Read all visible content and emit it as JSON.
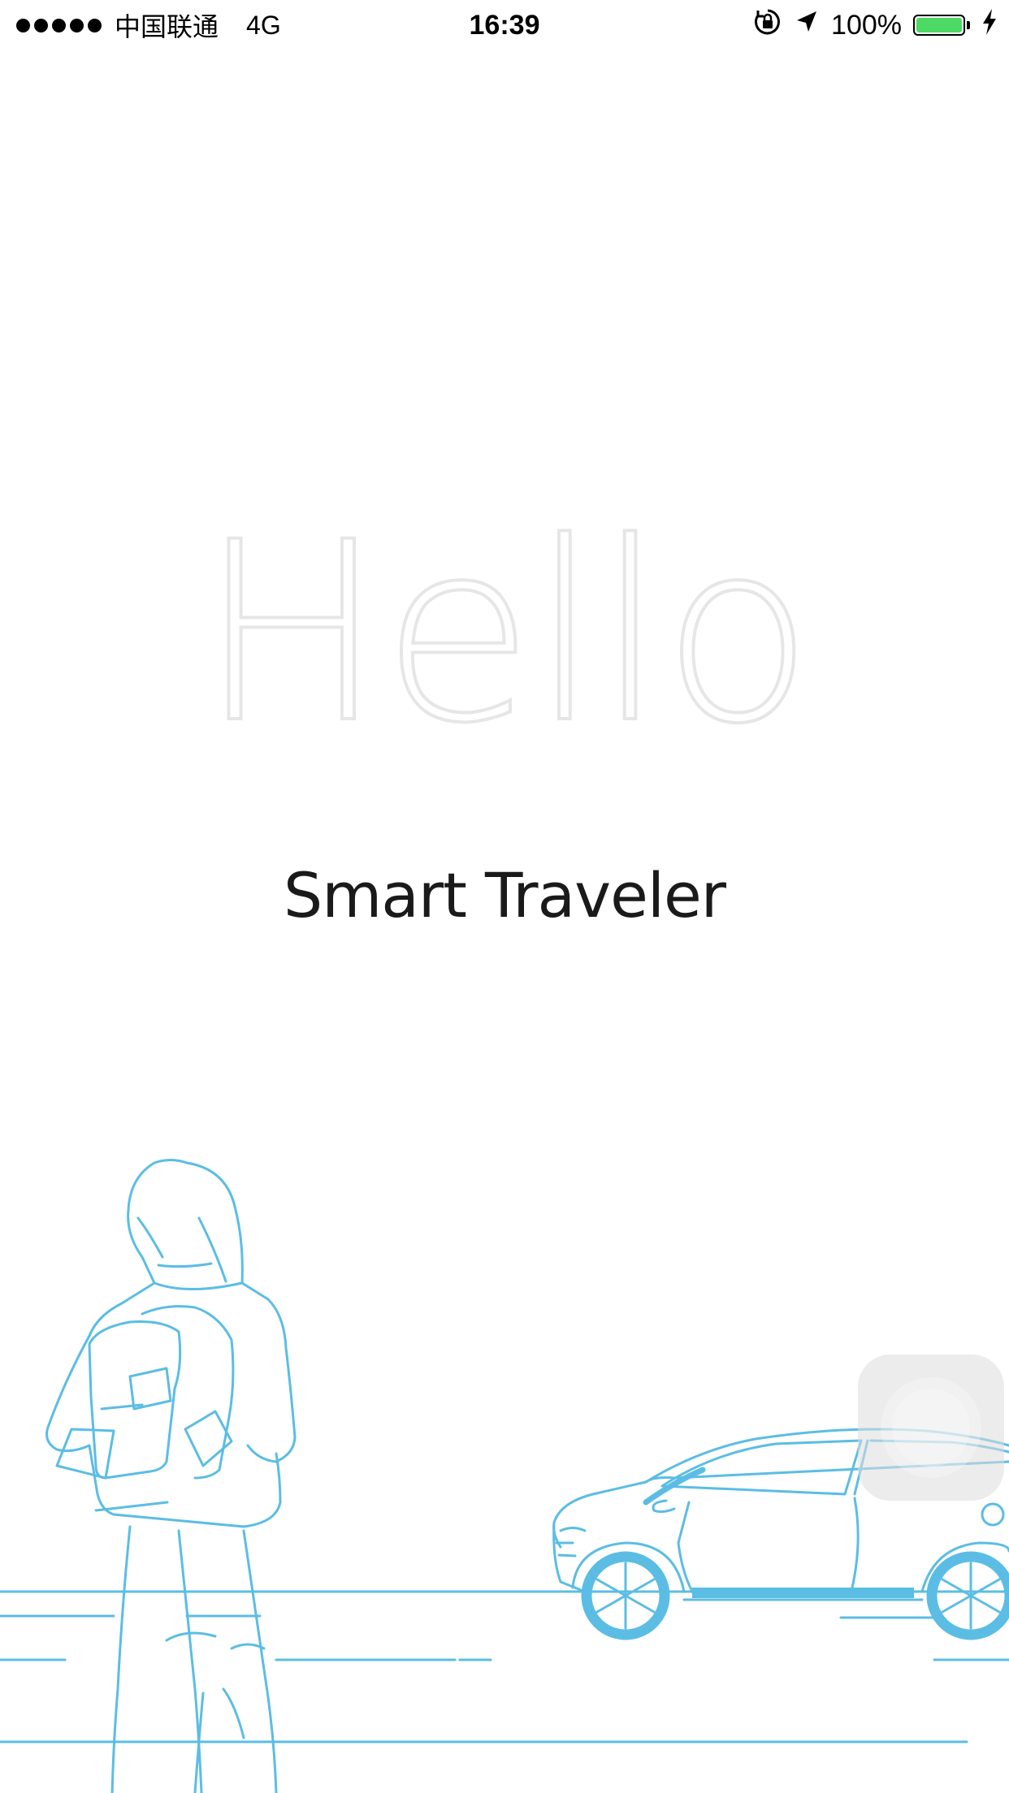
{
  "status_bar": {
    "carrier": "中国联通",
    "network": "4G",
    "time": "16:39",
    "battery_percent": "100%",
    "battery_level": 1.0,
    "battery_color": "#4cd964",
    "icons": [
      "signal-dots-icon",
      "rotation-lock-icon",
      "location-arrow-icon",
      "battery-icon",
      "charging-bolt-icon"
    ]
  },
  "splash": {
    "headline": "Hello",
    "subtitle": "Smart Traveler"
  },
  "illustration": {
    "line_color": "#5bbde4",
    "subjects": [
      "hooded-traveler-with-backpack",
      "car",
      "road-lines"
    ]
  }
}
